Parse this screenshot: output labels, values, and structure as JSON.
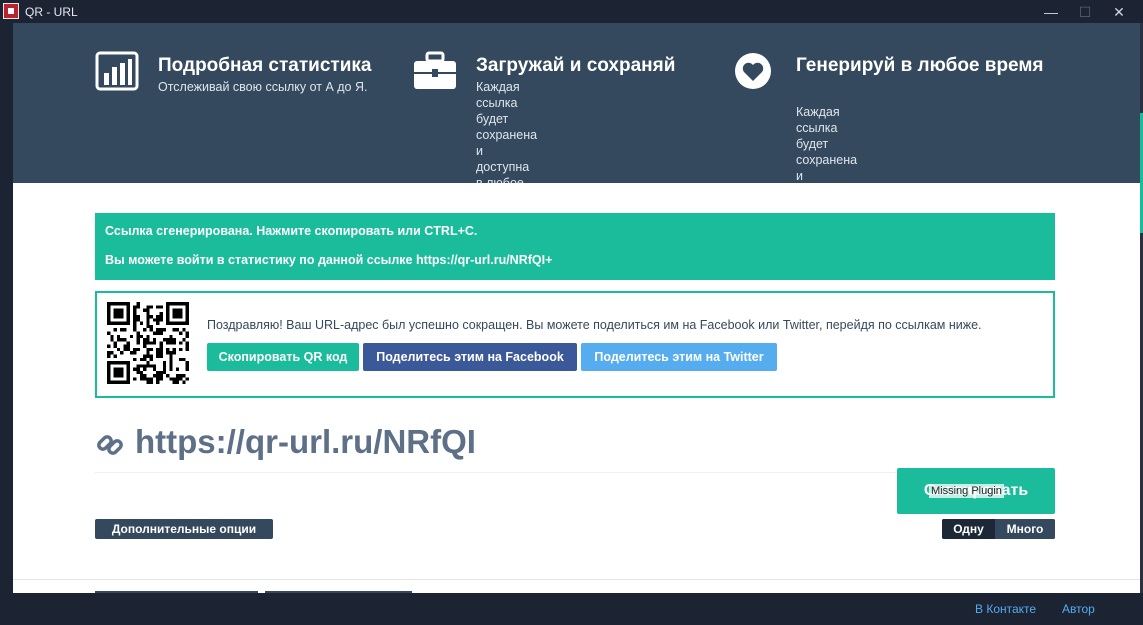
{
  "window": {
    "title": "QR - URL",
    "minimize": "—",
    "maximize": "☐",
    "close": "✕"
  },
  "features": [
    {
      "icon": "bar-chart-icon",
      "title": "Подробная статистика",
      "text": "Отслеживай свою ссылку от А до Я."
    },
    {
      "icon": "briefcase-icon",
      "title": "Загружай и сохраняй",
      "text": "Каждая ссылка будет сохранена и\nдоступна в любое время."
    },
    {
      "icon": "heart-icon",
      "title": "Генерируй в любое время",
      "text": "Каждая ссылка будет сохранена и\nдоступна в любое время."
    }
  ],
  "alert": {
    "line1": "Ссылка сгенерирована. Нажмите скопировать или CTRL+C.",
    "line2": "Вы можете войти в статистику по данной ссылке https://qr-url.ru/NRfQI+"
  },
  "share": {
    "message": "Поздравляю! Ваш URL-адрес был успешно сокращен. Вы можете поделиться им на Facebook или Twitter, перейдя по ссылкам ниже.",
    "copy_qr": "Скопировать QR код",
    "facebook": "Поделитесь этим на Facebook",
    "twitter": "Поделитесь этим на Twitter"
  },
  "short_url": "https://qr-url.ru/NRfQI",
  "copy_button": {
    "label": "Скопировать",
    "overlay": "Missing Plugin"
  },
  "options_button": "Дополнительные опции",
  "mode_toggle": {
    "one": "Одну",
    "many": "Много",
    "selected": "Одну"
  },
  "footer": {
    "vk": "В Контакте",
    "author": "Автор"
  },
  "colors": {
    "accent": "#1abc9c",
    "header_bg": "#34495e",
    "facebook": "#3b5998",
    "twitter": "#55acee",
    "window_bg": "#1c2333"
  }
}
